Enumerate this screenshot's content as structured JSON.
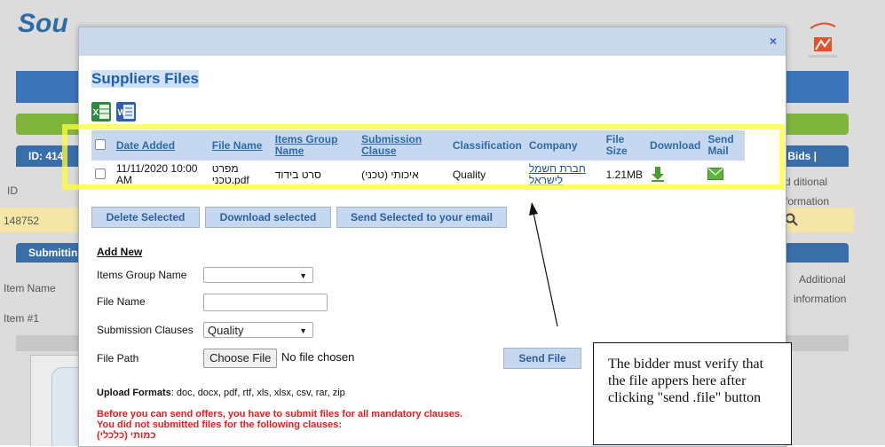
{
  "background": {
    "logo_text": "Sou",
    "id_tab": "ID: 414",
    "bids_tab": "t Bids  |",
    "id_label": "ID",
    "id_value": "148752",
    "additional_1": "d ditional",
    "additional_2": "formation",
    "submitting_tab": "Submittin",
    "item_name_header": "Item Name",
    "additional_header_1": "Additional",
    "additional_header_2": "information",
    "item_row": "Item #1"
  },
  "modal": {
    "title": "Suppliers Files",
    "close_glyph": "×",
    "table": {
      "headers": {
        "date_added": "Date Added",
        "file_name": "File Name",
        "items_group_name": "Items Group Name",
        "submission_clause": "Submission Clause",
        "classification": "Classification",
        "company": "Company",
        "file_size": "File Size",
        "download": "Download",
        "send_mail": "Send Mail"
      },
      "rows": [
        {
          "date_added": "11/11/2020 10:00 AM",
          "file_name": "מפרט טכני.pdf",
          "items_group_name": "סרט בידוד",
          "submission_clause": "(איכותי (טכני",
          "classification": "Quality",
          "company": "חברת חשמל לישראל",
          "file_size": "1.21MB"
        }
      ]
    },
    "buttons": {
      "delete_selected": "Delete Selected",
      "download_selected": "Download selected",
      "send_selected": "Send Selected to your email",
      "send_file": "Send File"
    },
    "form": {
      "add_new": "Add New",
      "items_group_label": "Items Group Name",
      "items_group_value": "",
      "file_name_label": "File Name",
      "file_name_value": "",
      "submission_clauses_label": "Submission Clauses",
      "submission_clauses_value": "Quality",
      "file_path_label": "File Path",
      "choose_file_label": "Choose File",
      "no_file_text": "No file chosen"
    },
    "upload_formats_label": "Upload Formats",
    "upload_formats_value": ": doc, docx, pdf, rtf, xls, xlsx, csv, rar, zip",
    "warning_1": "Before you can send offers, you have to submit files for all mandatory clauses.",
    "warning_2": "You did not submitted files for the following clauses:",
    "warning_3": "(כמותי (כלכלי"
  },
  "annotation": {
    "text": "The bidder must verify that the file appers here after clicking \"send .file\" button"
  },
  "colors": {
    "header_blue": "#c6d8ef",
    "link_blue": "#2f6aa8",
    "warning_red": "#e02020",
    "highlight_yellow": "#ffff3c"
  }
}
